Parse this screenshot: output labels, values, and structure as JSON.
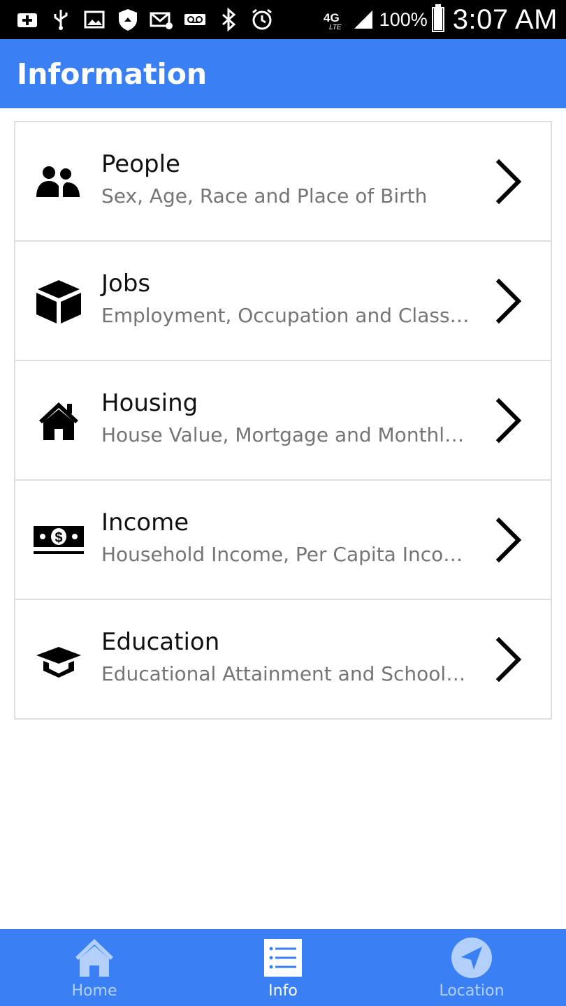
{
  "colors": {
    "accent": "#3a80f4",
    "nav_inactive": "#b3d0fb",
    "nav_active": "#ffffff",
    "divider": "#dedede",
    "subtitle": "#757575"
  },
  "status_bar": {
    "battery_text": "100%",
    "battery_level": 1.0,
    "time": "3:07 AM",
    "network": "4G LTE"
  },
  "app_bar": {
    "title": "Information"
  },
  "list": {
    "items": [
      {
        "title": "People",
        "subtitle": "Sex, Age, Race and Place of Birth",
        "icon": "people-icon"
      },
      {
        "title": "Jobs",
        "subtitle": "Employment, Occupation and Class of Worker",
        "icon": "cube-icon"
      },
      {
        "title": "Housing",
        "subtitle": "House Value, Mortgage and Monthly Costs",
        "icon": "house-icon"
      },
      {
        "title": "Income",
        "subtitle": "Household Income, Per Capita Income",
        "icon": "money-icon"
      },
      {
        "title": "Education",
        "subtitle": "Educational Attainment and School Enrollment",
        "icon": "graduation-cap-icon"
      }
    ]
  },
  "bottom_nav": {
    "items": [
      {
        "label": "Home",
        "icon": "home-icon",
        "active": false
      },
      {
        "label": "Info",
        "icon": "list-icon",
        "active": true
      },
      {
        "label": "Location",
        "icon": "navigation-arrow-icon",
        "active": false
      }
    ]
  }
}
